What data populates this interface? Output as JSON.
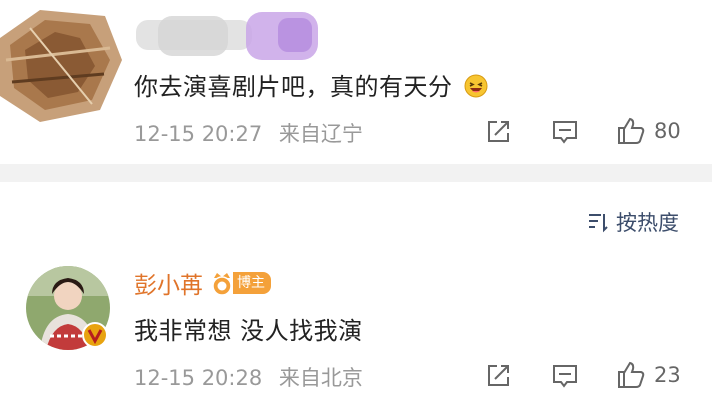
{
  "comments": [
    {
      "author": "",
      "text": "你去演喜剧片吧，真的有天分",
      "emoji_icon": "laughing-face-icon",
      "time": "12-15 20:27",
      "location": "来自辽宁",
      "likes": "80"
    },
    {
      "author": "彭小苒",
      "badge": "博主",
      "verified_icon": "verified-v-icon",
      "text": "我非常想 没人找我演",
      "time": "12-15 20:28",
      "location": "来自北京",
      "likes": "23"
    }
  ],
  "sort": {
    "label": "按热度",
    "icon": "sort-icon"
  },
  "colors": {
    "author_name": "#e0742a",
    "badge_bg": "#f4a13a",
    "verified": "#e8a310",
    "meta_text": "#999999",
    "sort_text": "#3c4d6b",
    "divider": "#f2f2f2"
  }
}
